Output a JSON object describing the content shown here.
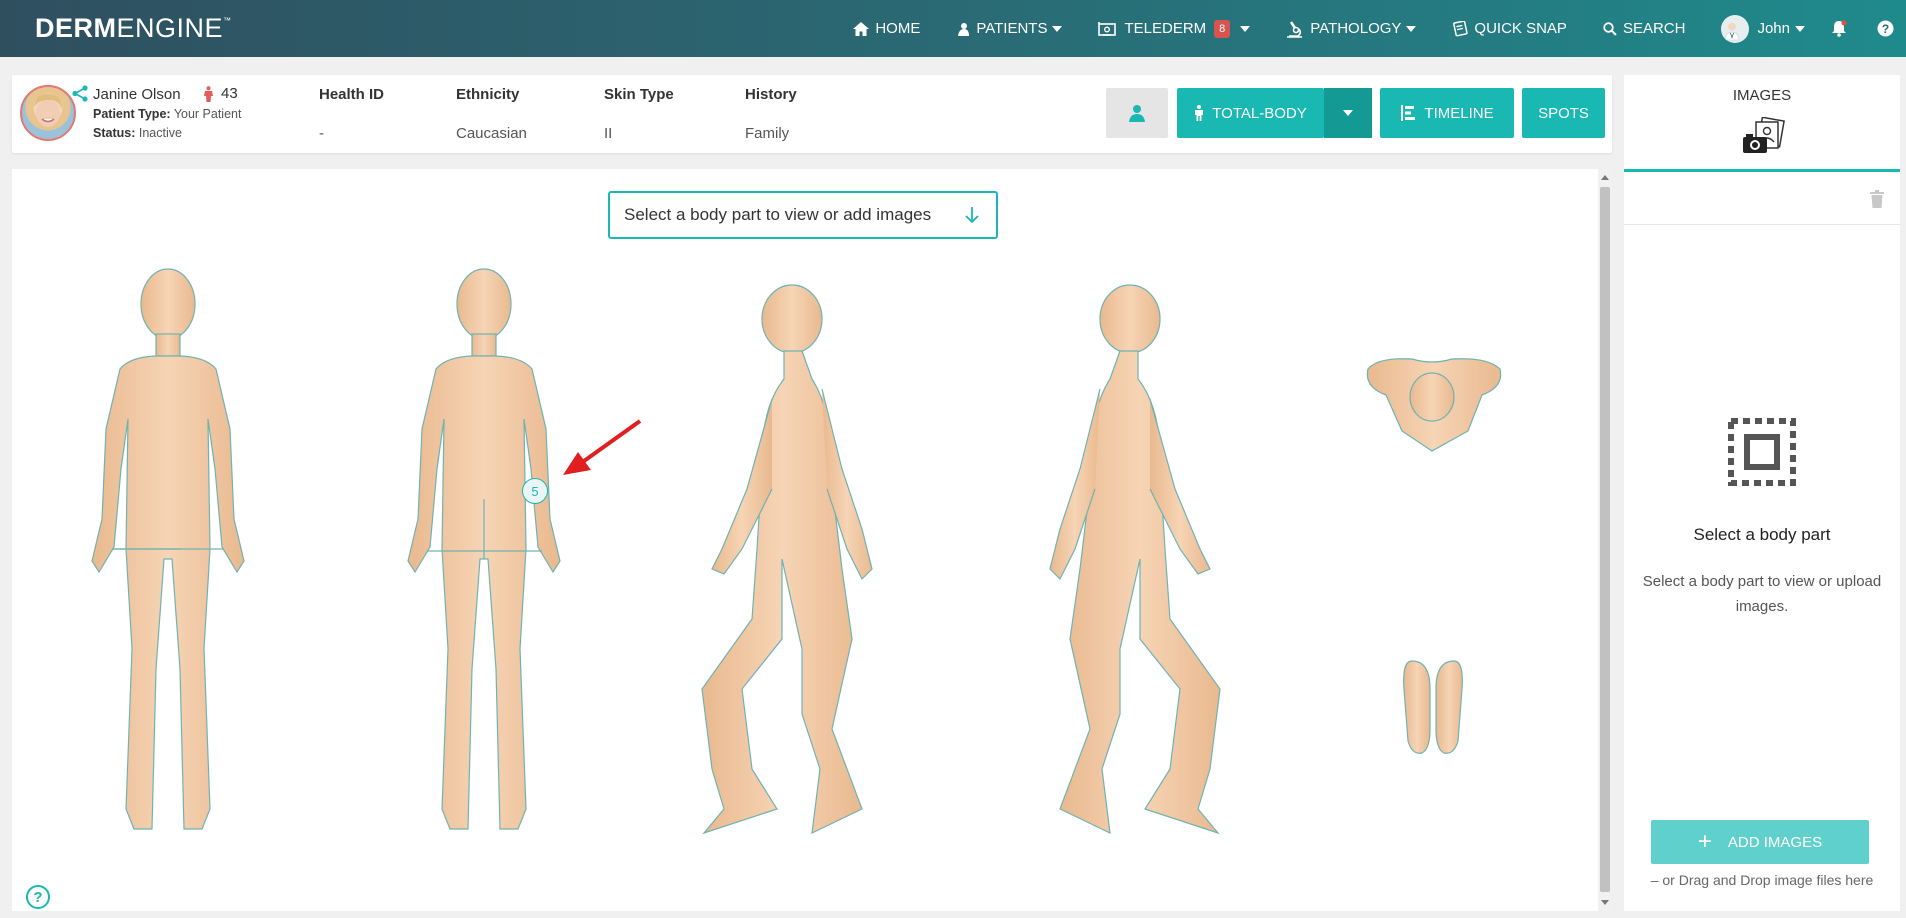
{
  "app": {
    "logo_bold": "DERM",
    "logo_light": "ENGINE",
    "logo_tm": "™"
  },
  "nav": {
    "home": "HOME",
    "patients": "PATIENTS",
    "telederm": "TELEDERM",
    "telederm_badge": "8",
    "pathology": "PATHOLOGY",
    "quick_snap": "QUICK SNAP",
    "search": "SEARCH",
    "user": "John"
  },
  "patient": {
    "name": "Janine Olson",
    "age": "43",
    "type_label": "Patient Type:",
    "type_value": "Your Patient",
    "status_label": "Status:",
    "status_value": "Inactive",
    "columns": [
      {
        "header": "Health ID",
        "value": "-"
      },
      {
        "header": "Ethnicity",
        "value": "Caucasian"
      },
      {
        "header": "Skin Type",
        "value": "II"
      },
      {
        "header": "History",
        "value": "Family"
      }
    ]
  },
  "toolbar": {
    "total_body": "TOTAL-BODY",
    "timeline": "TIMELINE",
    "spots": "SPOTS"
  },
  "main": {
    "select_prompt": "Select a body part to view or add images",
    "marker_count": "5",
    "help": "?"
  },
  "side": {
    "tab_label": "IMAGES",
    "empty_title": "Select a body part",
    "empty_desc": "Select a body part to view or upload images.",
    "add_images": "ADD IMAGES",
    "drag_hint": "– or Drag and Drop image files here"
  },
  "colors": {
    "accent": "#19b8b2",
    "skin": "#f2c9a5",
    "outline": "#6fb3b0",
    "arrow": "#e02020"
  }
}
